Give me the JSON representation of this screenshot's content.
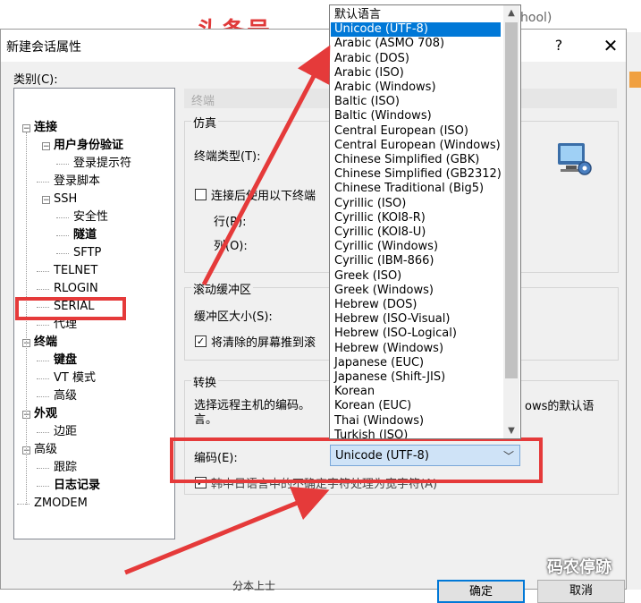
{
  "background": {
    "brand_text": "头条号",
    "tab_text": "hool)",
    "bottom_text": "分本上士"
  },
  "dialog": {
    "title": "新建会话属性",
    "help_glyph": "?",
    "close_glyph": "✕",
    "category_label": "类别(C):"
  },
  "tree": [
    {
      "label": "连接",
      "level": 0,
      "toggle": "−",
      "bold": true
    },
    {
      "label": "用户身份验证",
      "level": 1,
      "toggle": "−",
      "bold": true
    },
    {
      "label": "登录提示符",
      "level": 2,
      "toggle": "",
      "bold": false
    },
    {
      "label": "登录脚本",
      "level": 1,
      "toggle": "",
      "bold": false
    },
    {
      "label": "SSH",
      "level": 1,
      "toggle": "−",
      "bold": false
    },
    {
      "label": "安全性",
      "level": 2,
      "toggle": "",
      "bold": false
    },
    {
      "label": "隧道",
      "level": 2,
      "toggle": "",
      "bold": true
    },
    {
      "label": "SFTP",
      "level": 2,
      "toggle": "",
      "bold": false
    },
    {
      "label": "TELNET",
      "level": 1,
      "toggle": "",
      "bold": false
    },
    {
      "label": "RLOGIN",
      "level": 1,
      "toggle": "",
      "bold": false
    },
    {
      "label": "SERIAL",
      "level": 1,
      "toggle": "",
      "bold": false
    },
    {
      "label": "代理",
      "level": 1,
      "toggle": "",
      "bold": false
    },
    {
      "label": "终端",
      "level": 0,
      "toggle": "−",
      "bold": true
    },
    {
      "label": "键盘",
      "level": 1,
      "toggle": "",
      "bold": true
    },
    {
      "label": "VT 模式",
      "level": 1,
      "toggle": "",
      "bold": false
    },
    {
      "label": "高级",
      "level": 1,
      "toggle": "",
      "bold": false
    },
    {
      "label": "外观",
      "level": 0,
      "toggle": "−",
      "bold": true
    },
    {
      "label": "边距",
      "level": 1,
      "toggle": "",
      "bold": false
    },
    {
      "label": "高级",
      "level": 0,
      "toggle": "−",
      "bold": false
    },
    {
      "label": "跟踪",
      "level": 1,
      "toggle": "",
      "bold": false
    },
    {
      "label": "日志记录",
      "level": 1,
      "toggle": "",
      "bold": true
    },
    {
      "label": "ZMODEM",
      "level": 0,
      "toggle": "",
      "bold": false
    }
  ],
  "panel": {
    "section_title": "终端",
    "emulation": {
      "group_title": "仿真",
      "terminal_type_label": "终端类型(T):",
      "use_size_label": "连接后使用以下终端",
      "rows_label": "行(R):",
      "cols_label": "列(O):"
    },
    "scroll": {
      "group_title": "滚动缓冲区",
      "buffer_size_label": "缓冲区大小(S):",
      "push_label": "将清除的屏幕推到滚",
      "push_checked": true
    },
    "translate": {
      "group_title": "转换",
      "desc_left": "选择远程主机的编码。",
      "desc_left_2": "言。",
      "desc_right": "ows的默认语",
      "encoding_label": "编码(E):",
      "encoding_value": "Unicode (UTF-8)",
      "cjk_label": "韩中日语言中的不确定字符处理为宽字符(A)",
      "cjk_checked": true
    }
  },
  "dropdown": {
    "selected_index": 1,
    "options": [
      "默认语言",
      "Unicode (UTF-8)",
      "Arabic (ASMO 708)",
      "Arabic (DOS)",
      "Arabic (ISO)",
      "Arabic (Windows)",
      "Baltic (ISO)",
      "Baltic (Windows)",
      "Central European (ISO)",
      "Central European (Windows)",
      "Chinese Simplified (GBK)",
      "Chinese Simplified (GB2312)",
      "Chinese Traditional (Big5)",
      "Cyrillic (ISO)",
      "Cyrillic (KOI8-R)",
      "Cyrillic (KOI8-U)",
      "Cyrillic (Windows)",
      "Cyrillic (IBM-866)",
      "Greek (ISO)",
      "Greek (Windows)",
      "Hebrew (DOS)",
      "Hebrew (ISO-Visual)",
      "Hebrew (ISO-Logical)",
      "Hebrew (Windows)",
      "Japanese (EUC)",
      "Japanese (Shift-JIS)",
      "Korean",
      "Korean (EUC)",
      "Thai (Windows)",
      "Turkish (ISO)"
    ]
  },
  "buttons": {
    "ok": "确定",
    "cancel": "取消"
  },
  "watermark": "码农停跡",
  "colors": {
    "annotation_red": "#e53a3a",
    "selection_blue": "#0078d7"
  }
}
